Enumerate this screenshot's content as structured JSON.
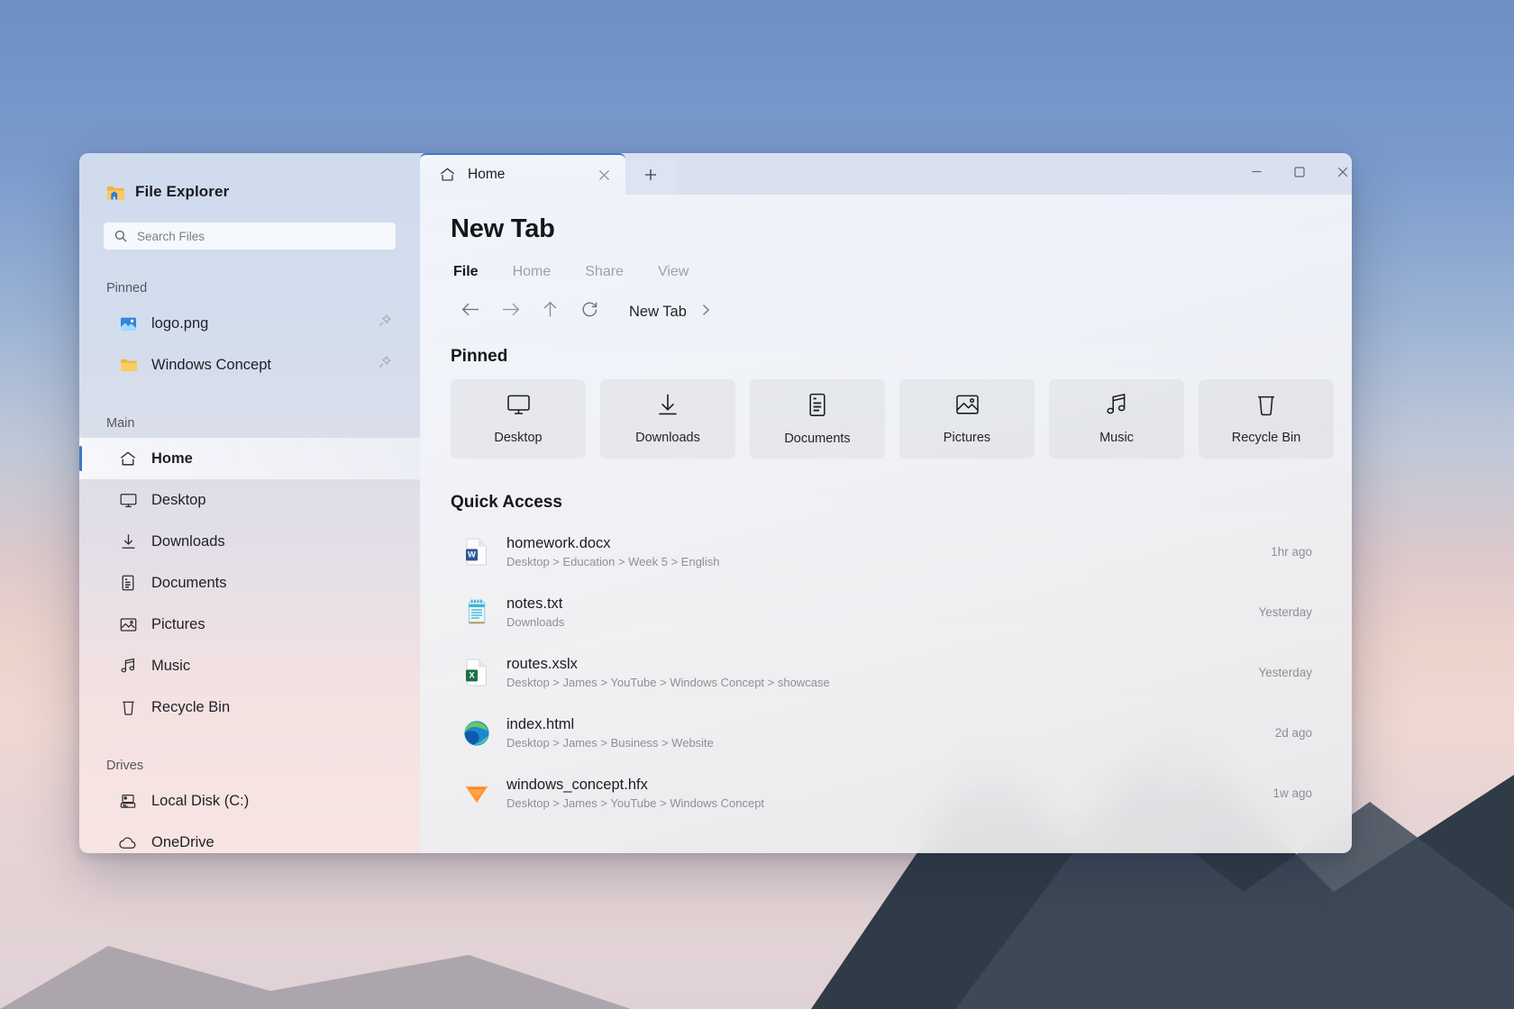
{
  "sidebar": {
    "app_title": "File Explorer",
    "app_icon": "folder-home-icon",
    "search": {
      "placeholder": "Search Files",
      "value": "",
      "icon": "search-icon"
    },
    "sections": [
      {
        "label": "Pinned",
        "items": [
          {
            "label": "logo.png",
            "icon": "image-file-icon",
            "pinned": true,
            "active": false
          },
          {
            "label": "Windows Concept",
            "icon": "folder-icon",
            "pinned": true,
            "active": false
          }
        ]
      },
      {
        "label": "Main",
        "items": [
          {
            "label": "Home",
            "icon": "home-icon",
            "pinned": false,
            "active": true
          },
          {
            "label": "Desktop",
            "icon": "monitor-icon",
            "pinned": false,
            "active": false
          },
          {
            "label": "Downloads",
            "icon": "download-icon",
            "pinned": false,
            "active": false
          },
          {
            "label": "Documents",
            "icon": "document-icon",
            "pinned": false,
            "active": false
          },
          {
            "label": "Pictures",
            "icon": "picture-icon",
            "pinned": false,
            "active": false
          },
          {
            "label": "Music",
            "icon": "music-icon",
            "pinned": false,
            "active": false
          },
          {
            "label": "Recycle Bin",
            "icon": "trash-icon",
            "pinned": false,
            "active": false
          }
        ]
      },
      {
        "label": "Drives",
        "items": [
          {
            "label": "Local Disk (C:)",
            "icon": "hard-drive-icon",
            "pinned": false,
            "active": false
          },
          {
            "label": "OneDrive",
            "icon": "cloud-icon",
            "pinned": false,
            "active": false
          }
        ]
      }
    ]
  },
  "titlebar": {
    "tabs": [
      {
        "label": "Home",
        "icon": "home-icon",
        "active": true
      }
    ],
    "new_tab_icon": "plus-icon",
    "close_tab_icon": "close-icon",
    "window_controls": [
      {
        "name": "minimize",
        "icon": "minimize-icon"
      },
      {
        "name": "maximize",
        "icon": "maximize-icon"
      },
      {
        "name": "close",
        "icon": "close-icon"
      }
    ]
  },
  "main": {
    "page_title": "New Tab",
    "ribbon": [
      {
        "label": "File",
        "active": true
      },
      {
        "label": "Home",
        "active": false
      },
      {
        "label": "Share",
        "active": false
      },
      {
        "label": "View",
        "active": false
      }
    ],
    "nav": {
      "back_icon": "arrow-left-icon",
      "forward_icon": "arrow-right-icon",
      "up_icon": "arrow-up-icon",
      "refresh_icon": "refresh-icon",
      "breadcrumb": "New Tab",
      "breadcrumb_chevron": "chevron-right-icon"
    },
    "pinned": {
      "heading": "Pinned",
      "tiles": [
        {
          "label": "Desktop",
          "icon": "monitor-icon"
        },
        {
          "label": "Downloads",
          "icon": "download-icon"
        },
        {
          "label": "Documents",
          "icon": "document-icon"
        },
        {
          "label": "Pictures",
          "icon": "picture-icon"
        },
        {
          "label": "Music",
          "icon": "music-icon"
        },
        {
          "label": "Recycle Bin",
          "icon": "trash-icon"
        }
      ]
    },
    "quick_access": {
      "heading": "Quick Access",
      "rows": [
        {
          "name": "homework.docx",
          "path": "Desktop > Education > Week 5 > English",
          "time": "1hr ago",
          "icon": "word-file-icon"
        },
        {
          "name": "notes.txt",
          "path": "Downloads",
          "time": "Yesterday",
          "icon": "notepad-file-icon"
        },
        {
          "name": "routes.xslx",
          "path": "Desktop > James > YouTube > Windows Concept > showcase",
          "time": "Yesterday",
          "icon": "excel-file-icon"
        },
        {
          "name": "index.html",
          "path": "Desktop > James > Business > Website",
          "time": "2d ago",
          "icon": "edge-file-icon"
        },
        {
          "name": "windows_concept.hfx",
          "path": "Desktop > James > YouTube > Windows Concept",
          "time": "1w ago",
          "icon": "hfx-file-icon"
        }
      ]
    }
  },
  "colors": {
    "accent": "#3a78c8",
    "text_primary": "#1d1e22",
    "text_muted": "#8d9098",
    "word_blue": "#2b579a",
    "excel_green": "#1d7044",
    "notepad_cyan": "#2bb3d4"
  }
}
